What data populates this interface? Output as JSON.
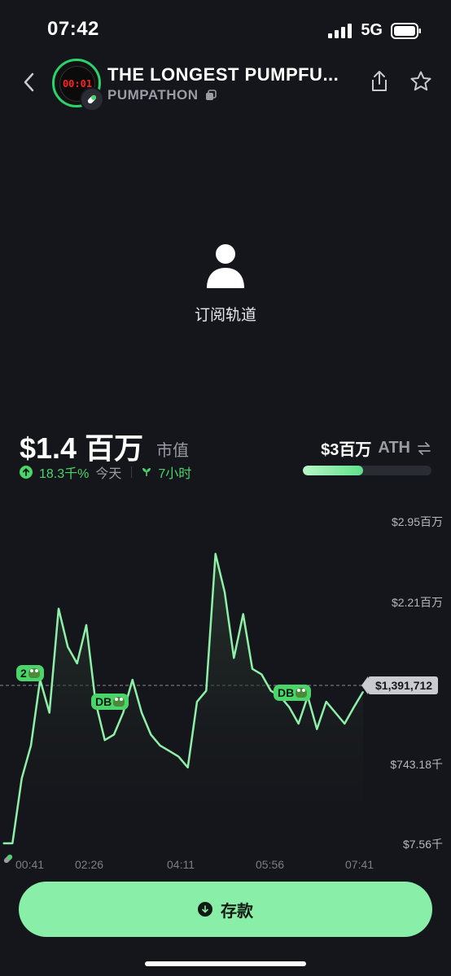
{
  "status_bar": {
    "time": "07:42",
    "network": "5G",
    "icons": [
      "signal-icon",
      "battery-icon"
    ]
  },
  "header": {
    "token_name": "THE LONGEST PUMPFU...",
    "ticker": "PUMPATHON",
    "avatar_timer": "00:01",
    "icons": [
      "back-chevron-icon",
      "share-icon",
      "star-icon",
      "copy-icon",
      "pill-icon"
    ]
  },
  "stream": {
    "label": "订阅轨道",
    "icon": "person-icon"
  },
  "market": {
    "cap_value": "$1.4 百万",
    "cap_label": "市值",
    "change_pct": "18.3千%",
    "change_period": "今天",
    "age": "7小时",
    "ath_value": "$3百万",
    "ath_label": "ATH",
    "ath_progress": 0.47
  },
  "chart": {
    "y_labels": [
      "$2.95百万",
      "$2.21百万",
      "$743.18千",
      "$7.56千"
    ],
    "x_labels": [
      "00:41",
      "02:26",
      "04:11",
      "05:56",
      "07:41"
    ],
    "current_price": "$1,391,712",
    "markers": [
      {
        "label": "2"
      },
      {
        "label": "DB"
      },
      {
        "label": "DB"
      }
    ],
    "colors": {
      "line": "#8ef0a8",
      "fill_top": "#2a3a30",
      "marker": "#4ad56a"
    }
  },
  "chart_data": {
    "type": "line",
    "x_unit": "time",
    "x": [
      "00:41",
      "02:26",
      "04:11",
      "05:56",
      "07:41"
    ],
    "ylim": [
      7560,
      2950000
    ],
    "series": [
      {
        "values": [
          7560,
          7560,
          600000,
          900000,
          1500000,
          1200000,
          2150000,
          1800000,
          1650000,
          2000000,
          1300000,
          950000,
          1000000,
          1200000,
          1500000,
          1200000,
          1000000,
          900000,
          850000,
          800000,
          700000,
          1300000,
          1400000,
          2650000,
          2300000,
          1700000,
          2100000,
          1600000,
          1550000,
          1400000,
          1350000,
          1250000,
          1100000,
          1350000,
          1050000,
          1300000,
          1200000,
          1100000,
          1250000,
          1391712
        ]
      }
    ]
  },
  "deposit": {
    "label": "存款"
  }
}
